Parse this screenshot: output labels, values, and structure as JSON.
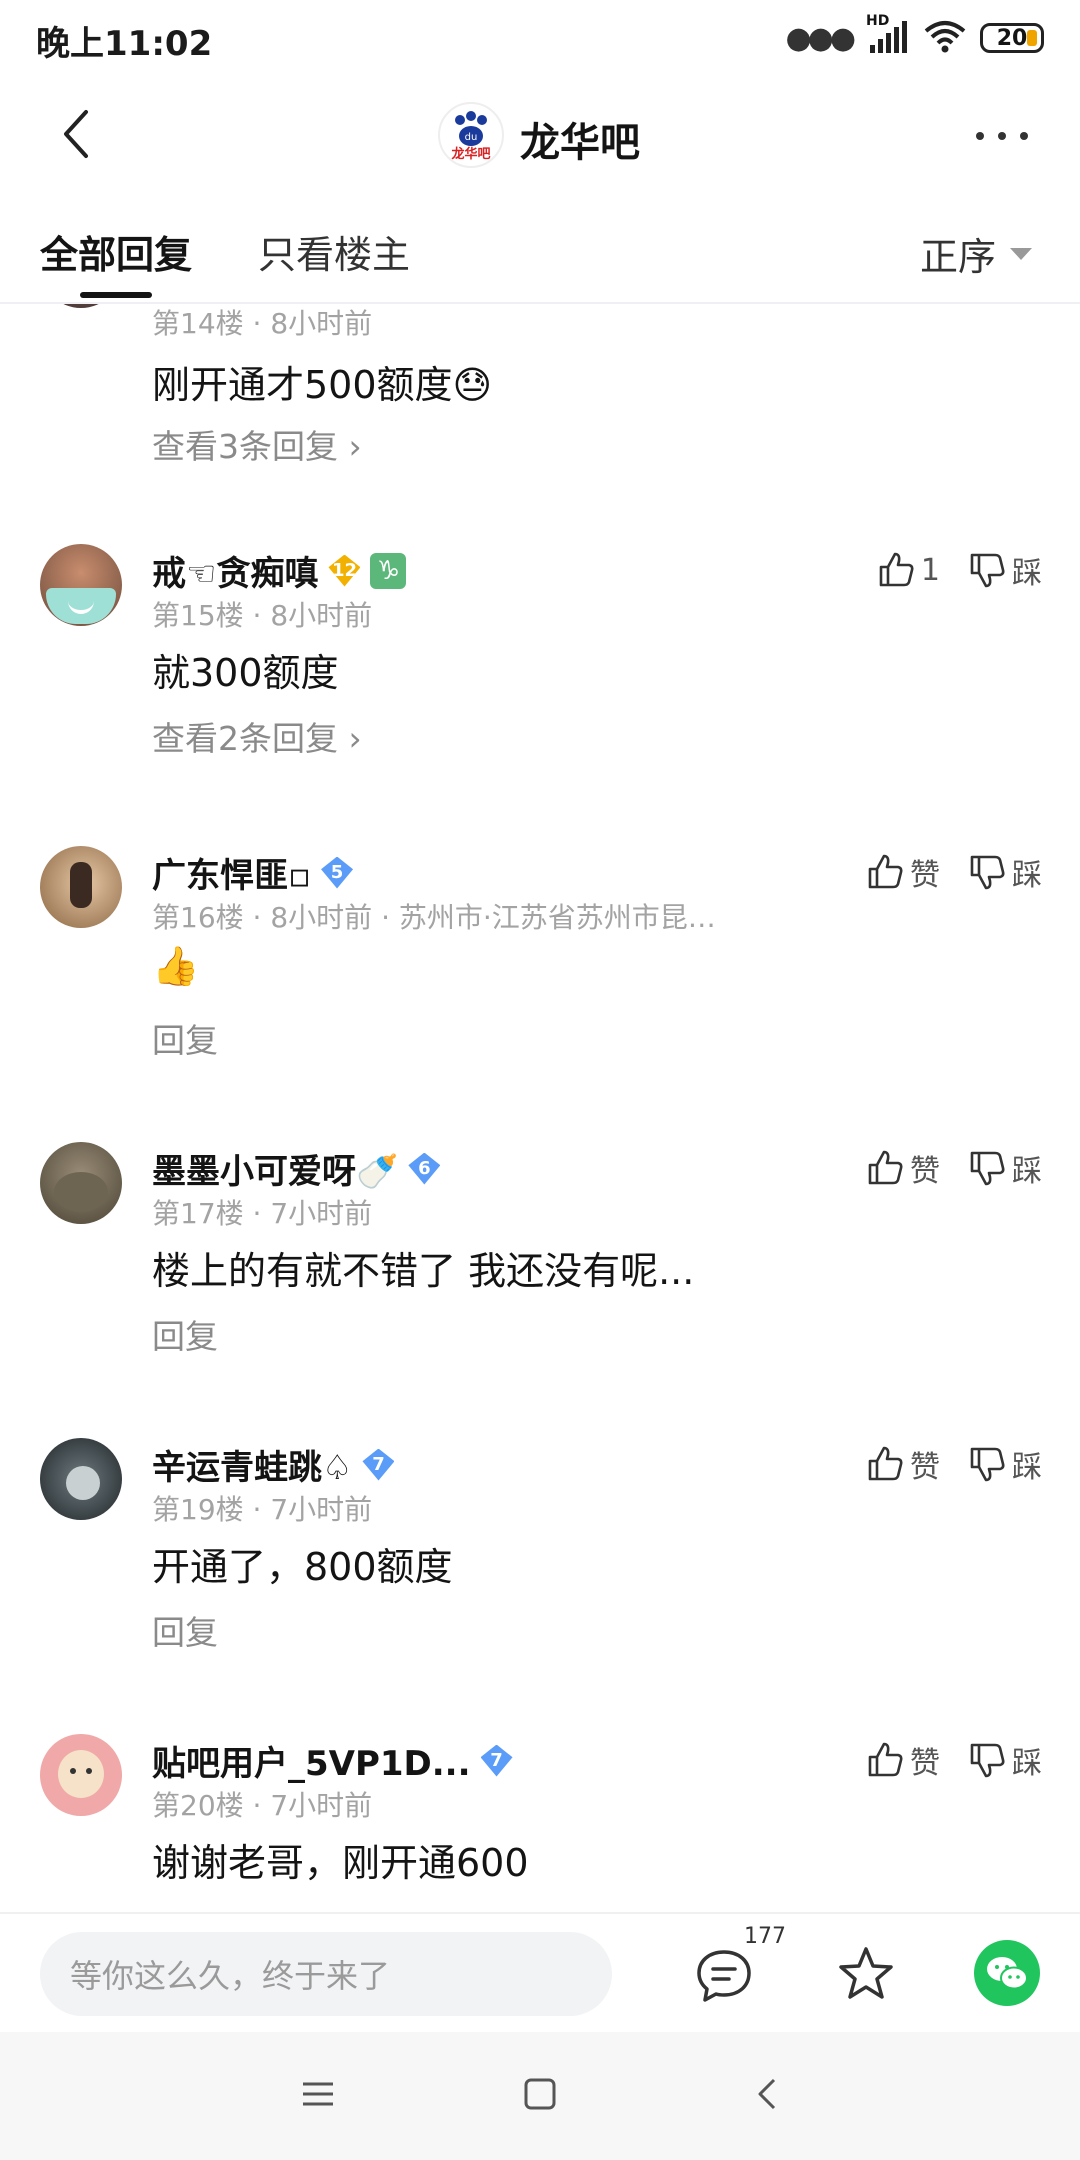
{
  "status_bar": {
    "time": "晚上11:02",
    "network": "HD",
    "battery": "20"
  },
  "navbar": {
    "forum_title": "龙华吧",
    "logo_text": "龙华吧"
  },
  "tabs": {
    "all": "全部回复",
    "owner_only": "只看楼主",
    "sort": "正序"
  },
  "floors": [
    {
      "floor": "第14楼",
      "time": "8小时前",
      "content": "刚开通才500额度",
      "emoji": "😓",
      "replies": "查看3条回复"
    },
    {
      "username": "戒☜贪痴嗔",
      "level": "12",
      "zodiac": "♑",
      "floor": "第15楼",
      "time": "8小时前",
      "like_count": "1",
      "dislike": "踩",
      "content": "就300额度",
      "replies": "查看2条回复"
    },
    {
      "username": "广东悍匪▫",
      "level": "5",
      "floor": "第16楼",
      "time": "8小时前",
      "location": "苏州市·江苏省苏州市昆…",
      "like": "赞",
      "dislike": "踩",
      "content": "👍",
      "replies": "回复"
    },
    {
      "username": "墨墨小可爱呀🍼",
      "level": "6",
      "floor": "第17楼",
      "time": "7小时前",
      "like": "赞",
      "dislike": "踩",
      "content": "楼上的有就不错了 我还没有呢...",
      "replies": "回复"
    },
    {
      "username": "辛运青蛙跳♤",
      "level": "7",
      "floor": "第19楼",
      "time": "7小时前",
      "like": "赞",
      "dislike": "踩",
      "content": "开通了，800额度",
      "replies": "回复"
    },
    {
      "username": "贴吧用户_5VP1D...",
      "level": "7",
      "floor": "第20楼",
      "time": "7小时前",
      "like": "赞",
      "dislike": "踩",
      "content": "谢谢老哥，刚开通600"
    }
  ],
  "meta_separator": " · ",
  "bottom_bar": {
    "input_placeholder": "等你这么久，终于来了",
    "comment_count": "177"
  },
  "colors": {
    "accent_green": "#21c55d",
    "meta_gray": "#a3a3a3",
    "level_gold": "#f2b100",
    "level_blue": "#5b9cf8"
  }
}
